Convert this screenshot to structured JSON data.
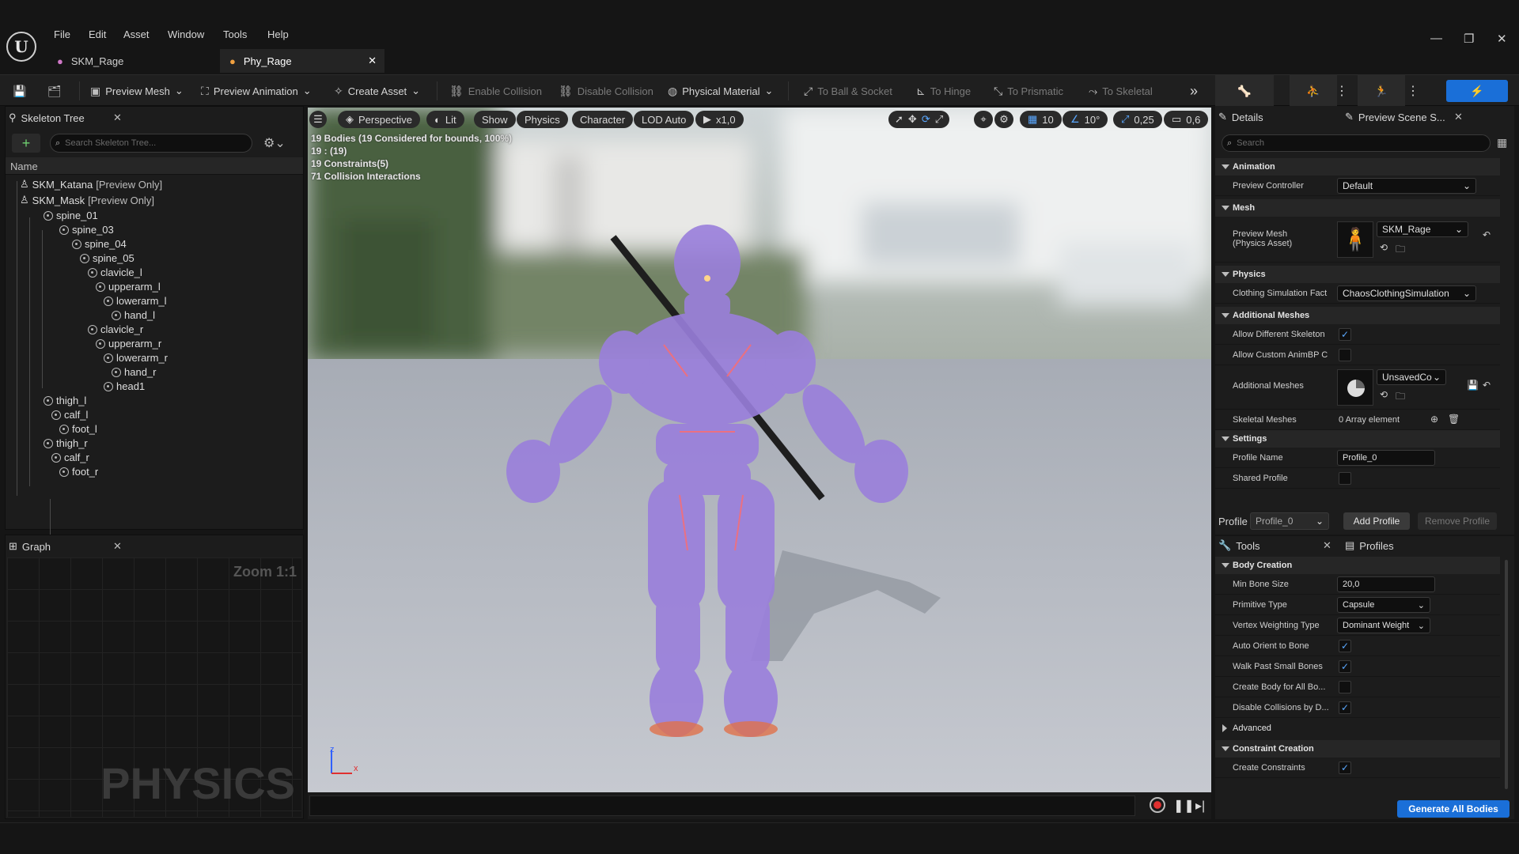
{
  "menu": {
    "file": "File",
    "edit": "Edit",
    "asset": "Asset",
    "window": "Window",
    "tools": "Tools",
    "help": "Help"
  },
  "doc_tabs": [
    {
      "label": "SKM_Rage",
      "icon": "mesh-icon",
      "active": false
    },
    {
      "label": "Phy_Rage",
      "icon": "physics-asset-icon",
      "active": true
    }
  ],
  "toolbar": {
    "preview_mesh": "Preview Mesh",
    "preview_animation": "Preview Animation",
    "create_asset": "Create Asset",
    "enable_collision": "Enable Collision",
    "disable_collision": "Disable Collision",
    "physical_material": "Physical Material",
    "to_ball_socket": "To Ball & Socket",
    "to_hinge": "To Hinge",
    "to_prismatic": "To Prismatic",
    "to_skeletal": "To Skeletal"
  },
  "skeleton_tree": {
    "tab": "Skeleton Tree",
    "search_placeholder": "Search Skeleton Tree...",
    "column": "Name",
    "items": [
      {
        "label": "SKM_Katana",
        "suffix": "[Preview Only]"
      },
      {
        "label": "SKM_Mask",
        "suffix": "[Preview Only]"
      },
      {
        "label": "spine_01"
      },
      {
        "label": "spine_03"
      },
      {
        "label": "spine_04"
      },
      {
        "label": "spine_05"
      },
      {
        "label": "clavicle_l"
      },
      {
        "label": "upperarm_l"
      },
      {
        "label": "lowerarm_l"
      },
      {
        "label": "hand_l"
      },
      {
        "label": "clavicle_r"
      },
      {
        "label": "upperarm_r"
      },
      {
        "label": "lowerarm_r"
      },
      {
        "label": "hand_r"
      },
      {
        "label": "head1"
      },
      {
        "label": "thigh_l"
      },
      {
        "label": "calf_l"
      },
      {
        "label": "foot_l"
      },
      {
        "label": "thigh_r"
      },
      {
        "label": "calf_r"
      },
      {
        "label": "foot_r"
      }
    ]
  },
  "graph": {
    "tab": "Graph",
    "zoom": "Zoom 1:1",
    "watermark": "PHYSICS"
  },
  "viewport": {
    "perspective": "Perspective",
    "lit": "Lit",
    "show": "Show",
    "physics": "Physics",
    "character": "Character",
    "lod": "LOD Auto",
    "speed": "x1,0",
    "grid": "10",
    "angle": "10°",
    "scale": "0,25",
    "camera": "0,6",
    "info": [
      "19 Bodies (19 Considered for bounds, 100%)",
      "19 : (19)",
      "19 Constraints(5)",
      "71 Collision Interactions"
    ],
    "axis_z": "z",
    "axis_x": "x"
  },
  "details": {
    "tab": "Details",
    "tab2": "Preview Scene S...",
    "search_placeholder": "Search",
    "animation": "Animation",
    "preview_controller_label": "Preview Controller",
    "preview_controller_value": "Default",
    "mesh": "Mesh",
    "preview_mesh_label1": "Preview Mesh",
    "preview_mesh_label2": "(Physics Asset)",
    "preview_mesh_value": "SKM_Rage",
    "physics": "Physics",
    "clothing_label": "Clothing Simulation Fact",
    "clothing_value": "ChaosClothingSimulation",
    "additional_meshes": "Additional Meshes",
    "allow_diff_skel": "Allow Different Skeleton",
    "allow_custom_anim": "Allow Custom AnimBP C",
    "additional_meshes_label": "Additional Meshes",
    "additional_meshes_value": "UnsavedCo",
    "skeletal_meshes_label": "Skeletal Meshes",
    "skeletal_meshes_value": "0 Array element",
    "settings": "Settings",
    "profile_name_label": "Profile Name",
    "profile_name_value": "Profile_0",
    "shared_profile": "Shared Profile",
    "profile_label": "Profile",
    "profile_value": "Profile_0",
    "add_profile": "Add Profile",
    "remove_profile": "Remove Profile"
  },
  "tools": {
    "tab": "Tools",
    "tab2": "Profiles",
    "body_creation": "Body Creation",
    "min_bone_label": "Min Bone Size",
    "min_bone_value": "20,0",
    "primitive_label": "Primitive Type",
    "primitive_value": "Capsule",
    "vertex_label": "Vertex Weighting Type",
    "vertex_value": "Dominant Weight",
    "auto_orient": "Auto Orient to Bone",
    "walk_past": "Walk Past Small Bones",
    "create_body_all": "Create Body for All Bo...",
    "disable_collisions": "Disable Collisions by D...",
    "advanced": "Advanced",
    "constraint_creation": "Constraint Creation",
    "create_constraints": "Create Constraints",
    "generate": "Generate All Bodies"
  },
  "colors": {
    "accent": "#1a6fd8",
    "checkbox": "#5aa8ff",
    "viewport_floor": "#c3c6cd"
  }
}
